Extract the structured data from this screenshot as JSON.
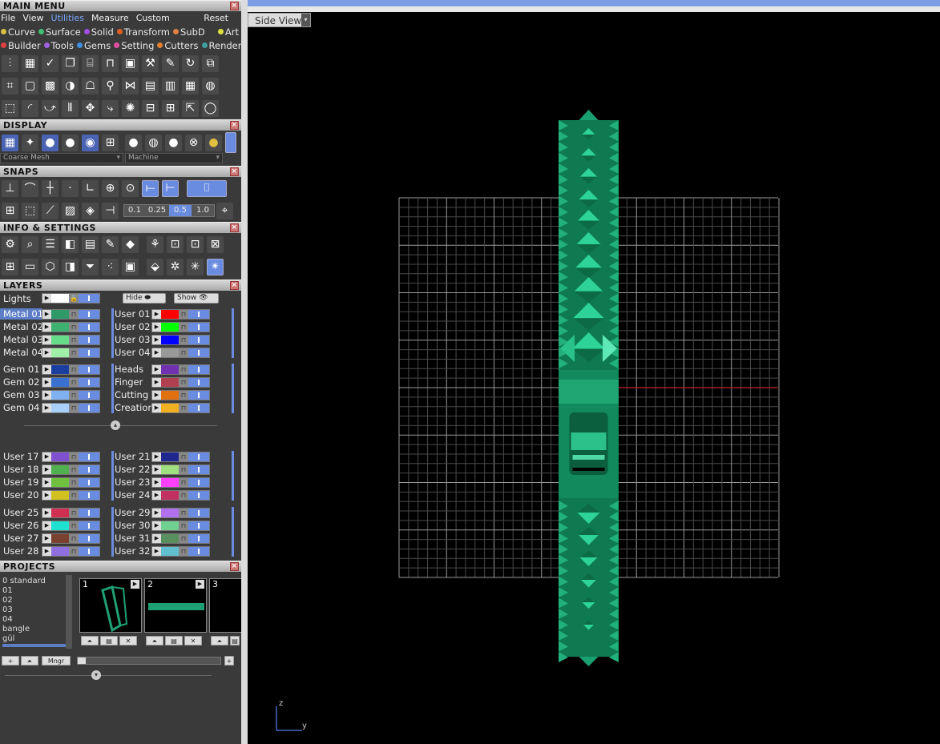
{
  "main_menu": {
    "title": "MAIN MENU",
    "menu": [
      "File",
      "View",
      "Utilities",
      "Measure",
      "Custom"
    ],
    "reset": "Reset",
    "categories_row1": [
      {
        "label": "Curve",
        "color": "#d8c040"
      },
      {
        "label": "Surface",
        "color": "#40c070"
      },
      {
        "label": "Solid",
        "color": "#a050e0"
      },
      {
        "label": "Transform",
        "color": "#e06020"
      },
      {
        "label": "SubD",
        "color": "#e08040"
      },
      {
        "label": "Art",
        "color": "#e0e040"
      }
    ],
    "categories_row2": [
      {
        "label": "Builder",
        "color": "#e04040"
      },
      {
        "label": "Tools",
        "color": "#a060e0"
      },
      {
        "label": "Gems",
        "color": "#4090e0"
      },
      {
        "label": "Setting",
        "color": "#e050a0"
      },
      {
        "label": "Cutters",
        "color": "#e08030"
      },
      {
        "label": "Render",
        "color": "#40a0a0"
      }
    ]
  },
  "display": {
    "title": "DISPLAY",
    "mesh_select": "Coarse Mesh",
    "material_select": "Machine"
  },
  "snaps": {
    "title": "SNAPS",
    "values": [
      "0.1",
      "0.25",
      "0.5",
      "1.0"
    ]
  },
  "info": {
    "title": "INFO & SETTINGS"
  },
  "layers": {
    "title": "LAYERS",
    "lights": "Lights",
    "hide": "Hide",
    "show": "Show",
    "groups": [
      {
        "left": [
          [
            "Metal 01",
            "#2e9a6a"
          ],
          [
            "Metal 02",
            "#3eb070"
          ],
          [
            "Metal 03",
            "#66dd88"
          ],
          [
            "Metal 04",
            "#a0f0a8"
          ]
        ],
        "right": [
          [
            "User 01",
            "#ff0000"
          ],
          [
            "User 02",
            "#00ff00"
          ],
          [
            "User 03",
            "#0000ff"
          ],
          [
            "User 04",
            "#999999"
          ]
        ]
      },
      {
        "left": [
          [
            "Gem 01",
            "#1a3fa0"
          ],
          [
            "Gem 02",
            "#3a70d0"
          ],
          [
            "Gem 03",
            "#80b0f0"
          ],
          [
            "Gem 04",
            "#a8d0f8"
          ]
        ],
        "right": [
          [
            "Heads",
            "#7030b0"
          ],
          [
            "Finger",
            "#b04050"
          ],
          [
            "Cutting",
            "#e07010"
          ],
          [
            "Creation",
            "#f0b020"
          ]
        ]
      },
      {
        "left": [
          [
            "User 17",
            "#8050d0"
          ],
          [
            "User 18",
            "#50b050"
          ],
          [
            "User 19",
            "#70c040"
          ],
          [
            "User 20",
            "#d0c020"
          ]
        ],
        "right": [
          [
            "User 21",
            "#202890"
          ],
          [
            "User 22",
            "#a0e080"
          ],
          [
            "User 23",
            "#ff40ff"
          ],
          [
            "User 24",
            "#c03060"
          ]
        ]
      },
      {
        "left": [
          [
            "User 25",
            "#d03050"
          ],
          [
            "User 26",
            "#20e0d0"
          ],
          [
            "User 27",
            "#7a4030"
          ],
          [
            "User 28",
            "#9070e0"
          ]
        ],
        "right": [
          [
            "User 29",
            "#b070f0"
          ],
          [
            "User 30",
            "#70d090"
          ],
          [
            "User 31",
            "#5a9060"
          ],
          [
            "User 32",
            "#60c0d0"
          ]
        ]
      }
    ]
  },
  "projects": {
    "title": "PROJECTS",
    "items": [
      "0 standard",
      "01",
      "02",
      "03",
      "04",
      "bangle",
      "gül"
    ],
    "slots": [
      "1",
      "2",
      "3"
    ],
    "mngr": "Mngr"
  },
  "viewport": {
    "view_name": "Side View",
    "axis_z": "z",
    "axis_y": "y"
  }
}
